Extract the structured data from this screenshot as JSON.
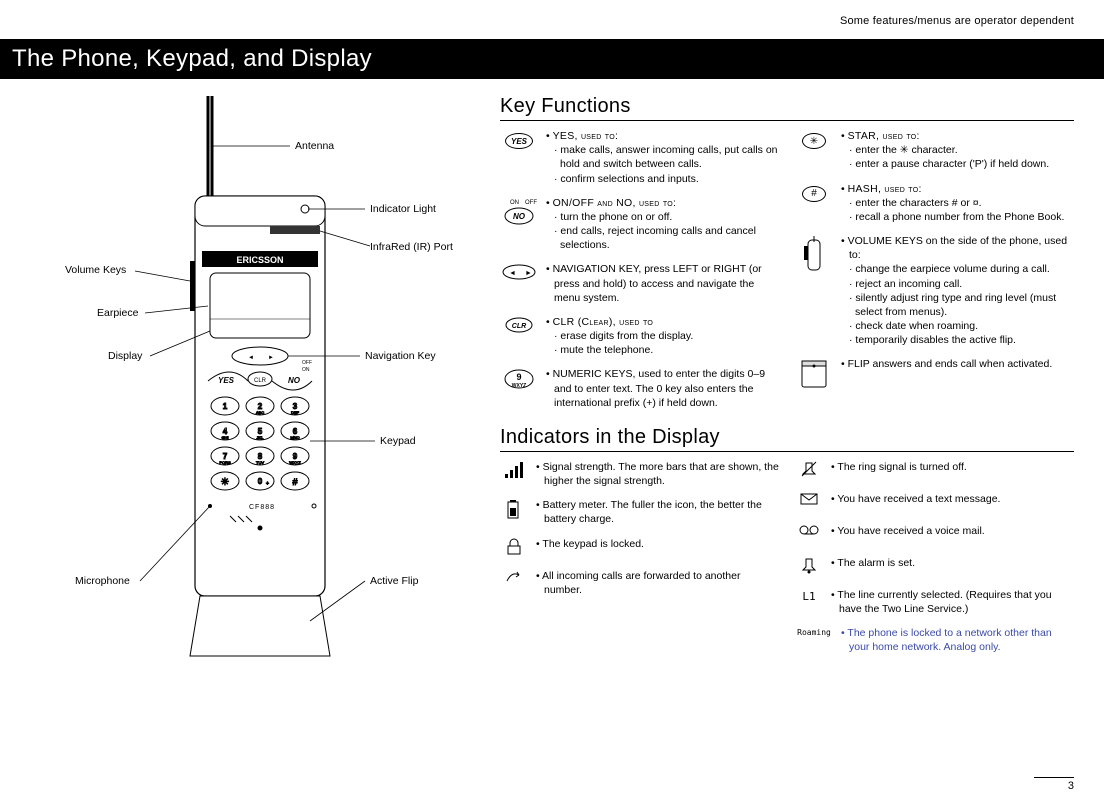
{
  "top_note": "Some features/menus are operator dependent",
  "title": "The Phone, Keypad, and Display",
  "phone_labels": {
    "antenna": "Antenna",
    "indicator_light": "Indicator Light",
    "ir_port": "InfraRed (IR) Port",
    "volume_keys": "Volume Keys",
    "earpiece": "Earpiece",
    "display": "Display",
    "navigation_key": "Navigation Key",
    "keypad": "Keypad",
    "microphone": "Microphone",
    "active_flip": "Active Flip"
  },
  "phone_model": "CF888",
  "phone_brand": "ERICSSON",
  "key_functions_heading": "Key Functions",
  "key_functions": {
    "yes": {
      "head": "YES, used to:",
      "items": [
        "make calls, answer incoming calls, put calls on hold and switch between calls.",
        "confirm selections and inputs."
      ]
    },
    "no": {
      "head": "ON/OFF and NO, used to:",
      "items": [
        "turn the phone on or off.",
        "end calls, reject incoming calls and cancel selections."
      ]
    },
    "nav": {
      "head": "NAVIGATION KEY, press LEFT or RIGHT (or press and hold) to access and navigate the menu system."
    },
    "clr": {
      "head": "CLR (Clear), used to",
      "items": [
        "erase digits from the display.",
        "mute the telephone."
      ]
    },
    "num": {
      "head": "NUMERIC KEYS, used to enter the digits 0–9 and to enter text. The 0 key also enters the international prefix (+) if held down."
    },
    "star": {
      "head": "STAR, used to:",
      "items": [
        "enter the ✳ character.",
        "enter a pause character ('P') if held down."
      ]
    },
    "hash": {
      "head": "HASH, used to:",
      "items": [
        "enter the characters # or ¤.",
        "recall a phone number from the Phone Book."
      ]
    },
    "vol": {
      "head": "VOLUME KEYS on the side of the phone, used to:",
      "items": [
        "change the earpiece volume during a call.",
        "reject an incoming call.",
        "silently adjust ring type and ring level (must select from menus).",
        "check date when roaming.",
        "temporarily disables the active flip."
      ]
    },
    "flip": {
      "head": "FLIP answers and ends call when activated."
    }
  },
  "indicators_heading": "Indicators in the Display",
  "indicators": {
    "signal": "Signal strength.\nThe more bars that are shown, the higher the signal strength.",
    "battery": "Battery meter.\nThe fuller the icon, the better the battery charge.",
    "lock": "The keypad is locked.",
    "fwd": "All incoming calls are forwarded to another number.",
    "ring_off": "The ring signal is turned off.",
    "sms": "You have received a text message.",
    "vm": "You have received a voice mail.",
    "alarm": "The alarm is set.",
    "line": "The line currently selected. (Requires that you have the Two Line Service.)",
    "roam": "The phone is locked to a network other than your home network. Analog only."
  },
  "indicator_labels": {
    "line": "L1",
    "roam": "Roaming"
  },
  "page_number": "3"
}
